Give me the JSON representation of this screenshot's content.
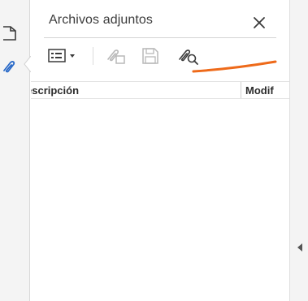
{
  "panel": {
    "title": "Archivos adjuntos"
  },
  "toolbar": {
    "buttons": [
      {
        "icon": "view-options-icon",
        "state": "enabled"
      },
      {
        "icon": "add-attachment-icon",
        "state": "disabled"
      },
      {
        "icon": "save-icon",
        "state": "disabled"
      },
      {
        "icon": "search-attachment-icon",
        "state": "enabled"
      }
    ]
  },
  "table": {
    "columns": [
      "escripción",
      "Modif"
    ]
  },
  "colors": {
    "annotation": "#ee6a1a",
    "active_icon": "#2a6ac8",
    "icon": "#3a3a3a",
    "disabled_icon": "#b8b8b8"
  }
}
